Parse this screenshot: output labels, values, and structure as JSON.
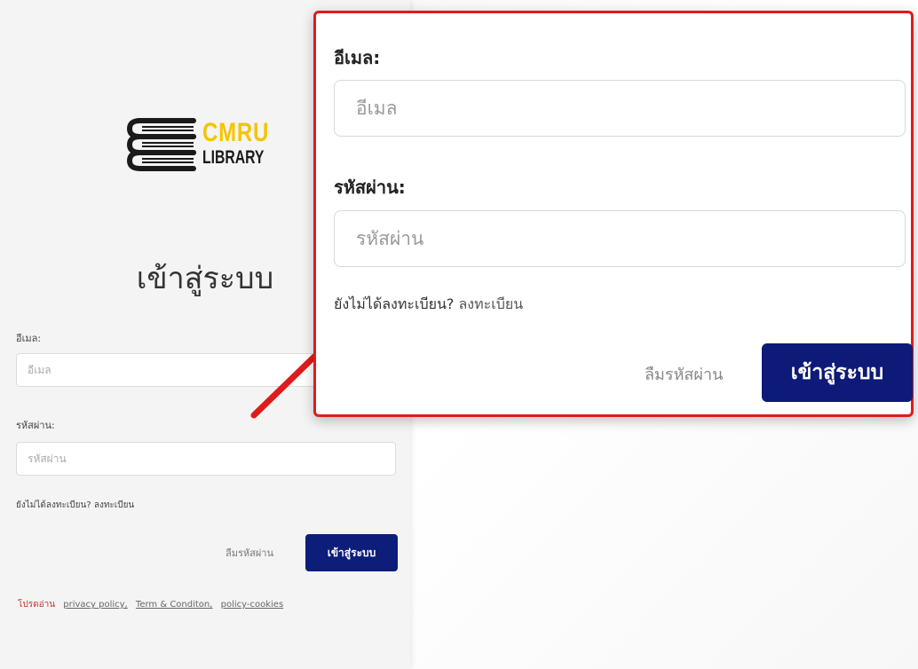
{
  "logo": {
    "line1": "CMRU",
    "line2": "LIBRARY",
    "icon": "books-stack-icon"
  },
  "page_title": "เข้าสู่ระบบ",
  "form": {
    "email_label": "อีเมล:",
    "email_placeholder": "อีเมล",
    "password_label": "รหัสผ่าน:",
    "password_placeholder": "รหัสผ่าน",
    "not_registered": "ยังไม่ได้ลงทะเบียน?",
    "register_link": "ลงทะเบียน",
    "forgot_password": "ลืมรหัสผ่าน",
    "login_button": "เข้าสู่ระบบ"
  },
  "policy": {
    "prefix": "โปรดอ่าน",
    "links": [
      "privacy policy,",
      "Term & Conditon,",
      "policy-cookies"
    ]
  },
  "colors": {
    "highlight_border": "#e01b1b",
    "button_bg": "#0d1a78",
    "logo_yellow": "#f5c400"
  }
}
